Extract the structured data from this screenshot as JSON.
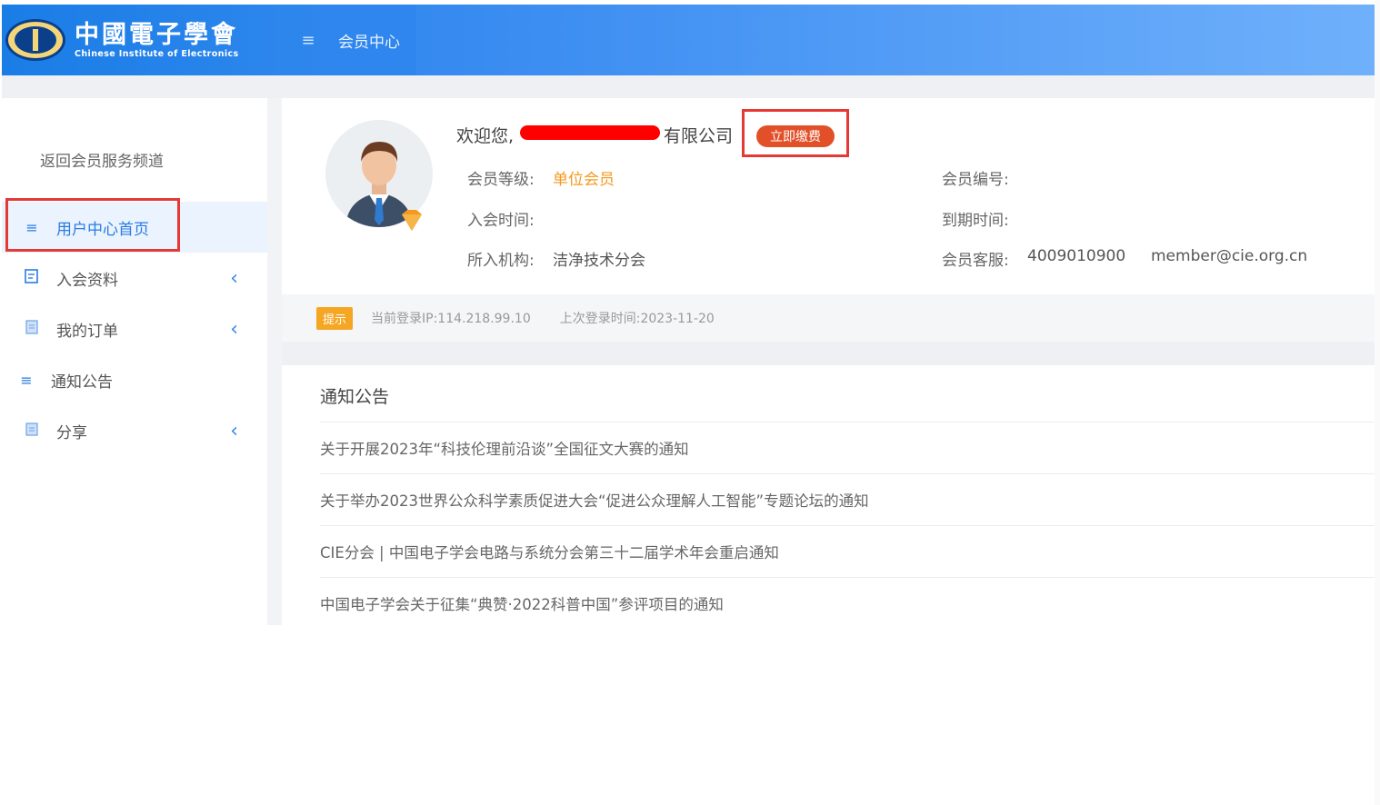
{
  "header": {
    "logo_cn": "中國電子學會",
    "logo_en": "Chinese Institute of Electronics",
    "menu_icon": "≡",
    "tab_label": "会员中心",
    "brand_color": "#2e86ee"
  },
  "sidebar": {
    "back_link": "返回会员服务频道",
    "items": [
      {
        "label": "用户中心首页",
        "icon": "list-icon",
        "active": true
      },
      {
        "label": "入会资料",
        "icon": "form-icon",
        "expandable": true
      },
      {
        "label": "我的订单",
        "icon": "document-icon",
        "expandable": true
      },
      {
        "label": "通知公告",
        "icon": "list-icon"
      },
      {
        "label": "分享",
        "icon": "share-icon",
        "expandable": true
      }
    ]
  },
  "profile": {
    "welcome_prefix": "欢迎您,",
    "welcome_suffix": "有限公司",
    "pay_button": "立即缴费",
    "member_level_label": "会员等级:",
    "member_level_value": "单位会员",
    "member_no_label": "会员编号:",
    "join_time_label": "入会时间:",
    "expire_time_label": "到期时间:",
    "org_label": "所入机构:",
    "org_value": "洁净技术分会",
    "service_label": "会员客服:",
    "service_phone": "4009010900",
    "service_email": "member@cie.org.cn"
  },
  "tips": {
    "badge": "提示",
    "ip_text": "当前登录IP:114.218.99.10",
    "last_login_text": "上次登录时间:2023-11-20"
  },
  "notices": {
    "title": "通知公告",
    "items": [
      "关于开展2023年“科技伦理前沿谈”全国征文大赛的通知",
      "关于举办2023世界公众科学素质促进大会“促进公众理解人工智能”专题论坛的通知",
      "CIE分会 | 中国电子学会电路与系统分会第三十二届学术年会重启通知",
      "中国电子学会关于征集“典赞·2022科普中国”参评项目的通知"
    ]
  }
}
